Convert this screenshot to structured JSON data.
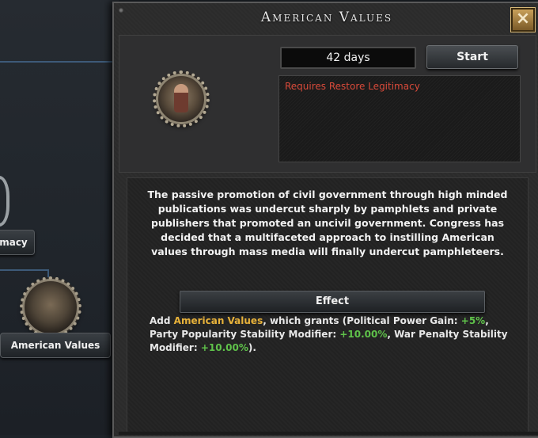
{
  "background_tree": {
    "node_partial_label": "macy",
    "node_label": "American Values"
  },
  "dialog": {
    "title": "American Values",
    "close_icon": "close-icon",
    "duration": "42 days",
    "start_label": "Start",
    "requirement": "Requires Restore Legitimacy",
    "focus_icon": "american-values-focus-icon",
    "description": "The passive promotion of civil government through high minded publications was undercut sharply by pamphlets and private publishers that promoted an uncivil government. Congress has decided that a multifaceted approach to instilling American values through mass media will finally undercut pamphleteers.",
    "effect_header": "Effect",
    "effect": {
      "prefix": "Add ",
      "idea_name": "American Values",
      "part1": ", which grants (Political Power Gain: ",
      "pp_value": "+5%",
      "part2": ", Party Popularity Stability Modifier: ",
      "party_value": "+10.00%",
      "part3": ", War Penalty Stability Modifier: ",
      "war_value": "+10.00%",
      "suffix": ")."
    }
  },
  "colors": {
    "requirement_red": "#d84a3a",
    "highlight_gold": "#e8b23a",
    "positive_green": "#5fc24a"
  }
}
